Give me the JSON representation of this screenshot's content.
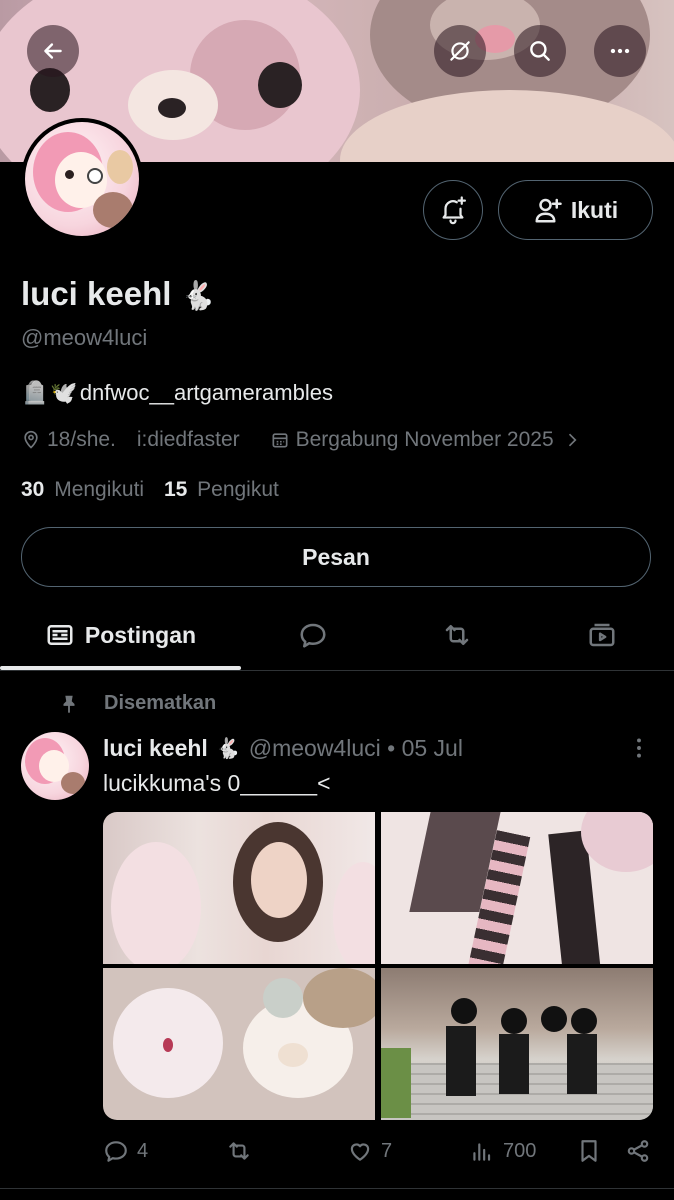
{
  "header": {
    "back_icon": "arrow-left-icon",
    "grok_icon": "grok-icon",
    "search_icon": "search-icon",
    "more_icon": "more-horizontal-icon"
  },
  "profile": {
    "name": "luci keehl",
    "name_emoji": "🐇",
    "handle": "@meow4luci",
    "bio_emoji_1": "🪦",
    "bio_emoji_2": "🕊️",
    "bio_text": "dnfwoc__artgamerambles",
    "location": "18/she.",
    "website": "i:diedfaster",
    "joined": "Bergabung November 2025",
    "following_count": "30",
    "following_label": "Mengikuti",
    "followers_count": "15",
    "followers_label": "Pengikut",
    "follow_label": "Ikuti",
    "message_label": "Pesan"
  },
  "tabs": [
    {
      "label": "Postingan",
      "icon": "posts-icon"
    },
    {
      "label": "",
      "icon": "replies-icon"
    },
    {
      "label": "",
      "icon": "reposts-icon"
    },
    {
      "label": "",
      "icon": "media-icon"
    }
  ],
  "post": {
    "pinned_label": "Disematkan",
    "author": "luci keehl",
    "author_emoji": "🐇",
    "handle_date": "@meow4luci • 05 Jul",
    "text": "lucikkuma's 0______<",
    "replies": "4",
    "reposts": "",
    "likes": "7",
    "views": "700"
  },
  "colors": {
    "background": "#000000",
    "text_primary": "#e7e9ea",
    "text_secondary": "#71767b",
    "border": "#536471",
    "divider": "#2f3336"
  }
}
